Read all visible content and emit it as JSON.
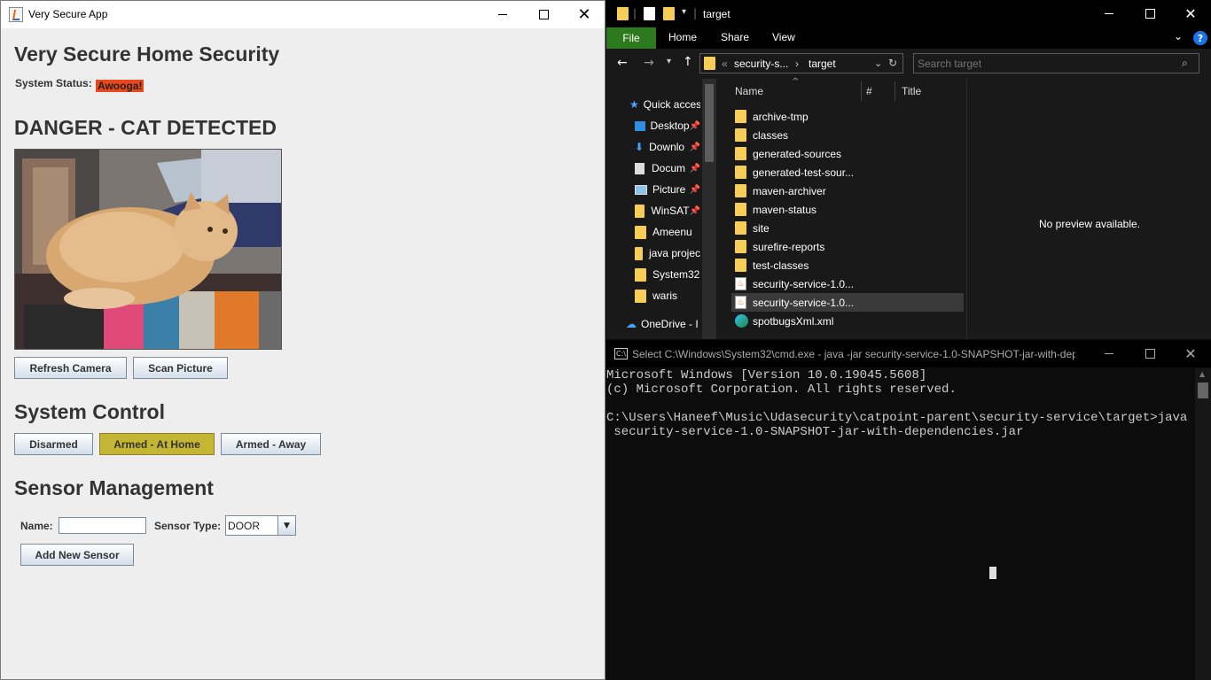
{
  "java_window": {
    "title": "Very Secure App",
    "heading": "Very Secure Home Security",
    "status_label": "System Status:",
    "status_value": "Awooga!",
    "danger_heading": "DANGER - CAT DETECTED",
    "camera_buttons": {
      "refresh": "Refresh Camera",
      "scan": "Scan Picture"
    },
    "system_control_heading": "System Control",
    "arming_buttons": [
      {
        "label": "Disarmed",
        "active": false
      },
      {
        "label": "Armed - At Home",
        "active": true
      },
      {
        "label": "Armed - Away",
        "active": false
      }
    ],
    "sensor_heading": "Sensor Management",
    "name_label": "Name:",
    "name_value": "",
    "sensor_type_label": "Sensor Type:",
    "sensor_type_selected": "DOOR",
    "add_sensor_button": "Add New Sensor",
    "active_color": "#c4b532",
    "status_color": "#e8481c"
  },
  "explorer": {
    "title": "target",
    "ribbon_tabs": [
      "File",
      "Home",
      "Share",
      "View"
    ],
    "breadcrumb": {
      "parent": "security-s...",
      "current": "target",
      "prefix": "«"
    },
    "search_placeholder": "Search target",
    "nav_items": [
      "Quick acces",
      "Desktop",
      "Downlo",
      "Docum",
      "Picture",
      "WinSAT",
      "Ameenu",
      "java projec",
      "System32",
      "waris",
      "OneDrive - I"
    ],
    "columns": {
      "name": "Name",
      "number": "#",
      "title": "Title"
    },
    "files": [
      {
        "name": "archive-tmp",
        "kind": "folder"
      },
      {
        "name": "classes",
        "kind": "folder"
      },
      {
        "name": "generated-sources",
        "kind": "folder"
      },
      {
        "name": "generated-test-sour...",
        "kind": "folder"
      },
      {
        "name": "maven-archiver",
        "kind": "folder"
      },
      {
        "name": "maven-status",
        "kind": "folder"
      },
      {
        "name": "site",
        "kind": "folder"
      },
      {
        "name": "surefire-reports",
        "kind": "folder"
      },
      {
        "name": "test-classes",
        "kind": "folder"
      },
      {
        "name": "security-service-1.0...",
        "kind": "jar"
      },
      {
        "name": "security-service-1.0...",
        "kind": "jar",
        "selected": true
      },
      {
        "name": "spotbugsXml.xml",
        "kind": "xml"
      }
    ],
    "preview_text": "No preview available."
  },
  "cmd": {
    "title": "Select C:\\Windows\\System32\\cmd.exe - java  -jar security-service-1.0-SNAPSHOT-jar-with-dep...",
    "lines": [
      "Microsoft Windows [Version 10.0.19045.5608]",
      "(c) Microsoft Corporation. All rights reserved.",
      "",
      "C:\\Users\\Haneef\\Music\\Udasecurity\\catpoint-parent\\security-service\\target>java -jar",
      " security-service-1.0-SNAPSHOT-jar-with-dependencies.jar"
    ]
  }
}
